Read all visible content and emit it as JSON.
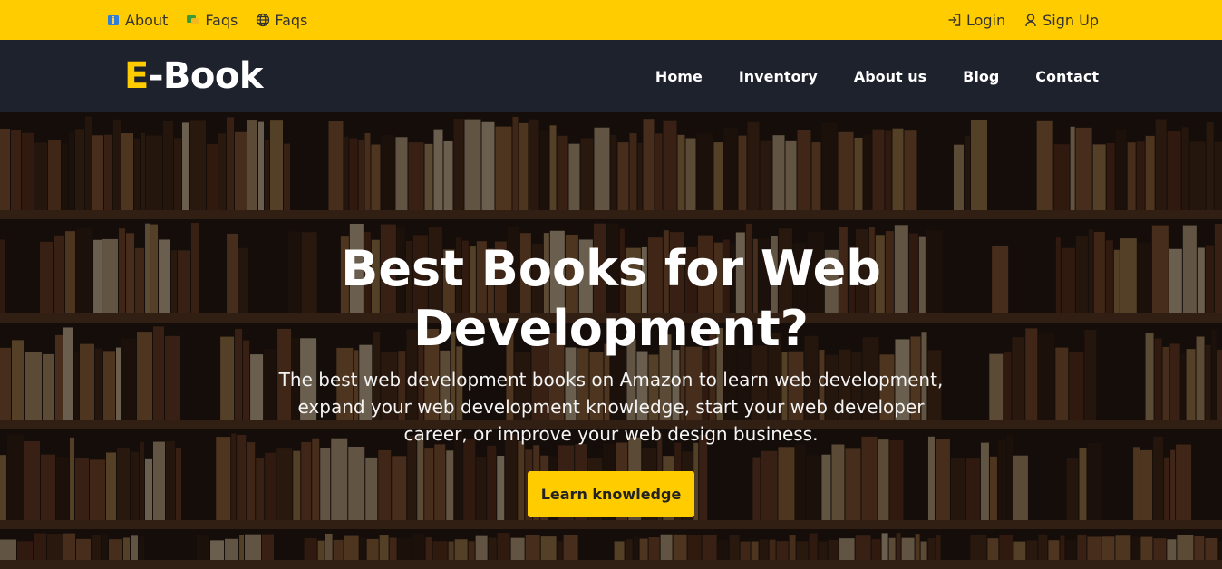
{
  "topbar": {
    "left": [
      {
        "label": "About",
        "icon": "info-icon"
      },
      {
        "label": "Faqs",
        "icon": "chat-icon"
      },
      {
        "label": "Faqs",
        "icon": "globe-icon"
      }
    ],
    "right": [
      {
        "label": "Login",
        "icon": "login-icon"
      },
      {
        "label": "Sign Up",
        "icon": "user-icon"
      }
    ],
    "bg_color": "#ffcc00"
  },
  "navbar": {
    "logo_accent": "E",
    "logo_rest": "-Book",
    "links": [
      "Home",
      "Inventory",
      "About us",
      "Blog",
      "Contact"
    ],
    "bg_color": "#1e222d"
  },
  "hero": {
    "title": "Best Books for Web Development?",
    "description": "The best web development books on Amazon to learn web development, expand your web development knowledge, start your web developer career, or improve your web design business.",
    "button_label": "Learn knowledge",
    "accent_color": "#ffcc00"
  }
}
